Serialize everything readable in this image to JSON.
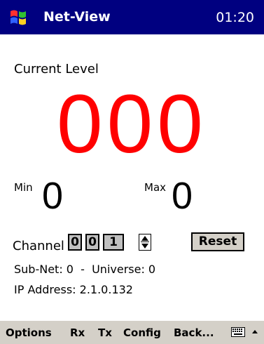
{
  "title_bar": {
    "app_title": "Net-View",
    "clock": "01:20",
    "start_icon": "windows-flag-icon"
  },
  "level": {
    "label": "Current Level",
    "value": "000",
    "color": "#ff0000"
  },
  "min": {
    "label": "Min",
    "value": "0"
  },
  "max": {
    "label": "Max",
    "value": "0"
  },
  "channel": {
    "label": "Channel",
    "digits": [
      "0",
      "0",
      "1"
    ],
    "spinner_icon": "up-down-spinner-icon"
  },
  "reset_label": "Reset",
  "info": {
    "subnet_line": "Sub-Net: 0  -  Universe: 0",
    "ip_line": "IP Address: 2.1.0.132"
  },
  "menu": {
    "items": [
      "Options",
      "Rx",
      "Tx",
      "Config",
      "Back..."
    ],
    "keyboard_icon": "keyboard-icon",
    "sip_arrow_icon": "up-arrow-icon"
  },
  "colors": {
    "title_bar_bg": "#000080",
    "menu_bar_bg": "#d4d0c8"
  }
}
